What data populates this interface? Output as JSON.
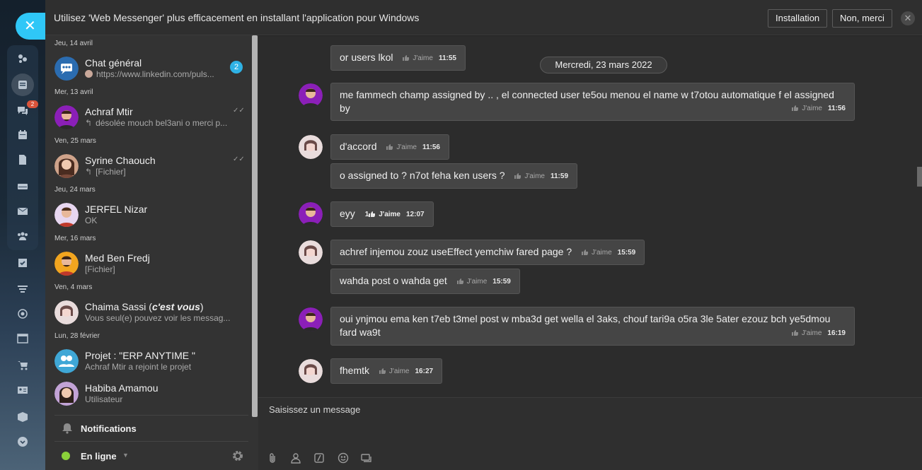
{
  "banner": {
    "text": "Utilisez 'Web Messenger' plus efficacement en installant l'application pour Windows",
    "install_label": "Installation",
    "decline_label": "Non, merci",
    "close_icon": "close-icon"
  },
  "rail": {
    "close_icon": "close-icon",
    "notification_count": "2"
  },
  "chat_list": {
    "groups": [
      {
        "date": "Jeu, 14 avril"
      },
      {
        "date": "Mer, 13 avril"
      },
      {
        "date": "Ven, 25 mars"
      },
      {
        "date": "Jeu, 24 mars"
      },
      {
        "date": "Mer, 16 mars"
      },
      {
        "date": "Ven, 4 mars"
      },
      {
        "date": "Lun, 28 février"
      }
    ],
    "chats": [
      {
        "name": "Chat général",
        "preview": "https://www.linkedin.com/puls...",
        "unread": "2"
      },
      {
        "name": "Achraf Mtir",
        "preview": "désolée mouch bel3ani o merci p..."
      },
      {
        "name": "Syrine Chaouch",
        "preview": "[Fichier]"
      },
      {
        "name": "JERFEL Nizar",
        "preview": "OK"
      },
      {
        "name": "Med Ben Fredj",
        "preview": "[Fichier]"
      },
      {
        "name": "Chaima Sassi",
        "name_suffix": "c'est vous",
        "preview": "Vous seul(e) pouvez voir les messag..."
      },
      {
        "name": "Projet : \"ERP ANYTIME \"",
        "preview": "Achraf Mtir a rejoint le projet"
      },
      {
        "name": "Habiba Amamou",
        "preview": "Utilisateur"
      }
    ],
    "notifications_label": "Notifications",
    "status_label": "En ligne"
  },
  "conversation": {
    "day_separator": "Mercredi, 23 mars 2022",
    "like_label": "J'aime",
    "messages": [
      {
        "text": "or users lkol",
        "time": "11:55"
      },
      {
        "text": "me fammech champ assigned by .. , el connected user te5ou menou el name w t7otou automatique f el assigned by",
        "time": "11:56"
      },
      {
        "text": "d'accord",
        "time": "11:56"
      },
      {
        "text": "o assigned to ? n7ot feha ken users ?",
        "time": "11:59"
      },
      {
        "text": "eyy",
        "time": "12:07",
        "likes": "1"
      },
      {
        "text": "achref injemou zouz useEffect yemchiw fared page ?",
        "time": "15:59"
      },
      {
        "text": "wahda post o wahda get",
        "time": "15:59"
      },
      {
        "text": "oui ynjmou ema ken t7eb t3mel post w mba3d get wella el 3aks, chouf tari9a o5ra 3le 5ater ezouz bch ye5dmou fard wa9t",
        "time": "16:19"
      },
      {
        "text": "fhemtk",
        "time": "16:27"
      }
    ]
  },
  "composer": {
    "placeholder": "Saisissez un message"
  }
}
